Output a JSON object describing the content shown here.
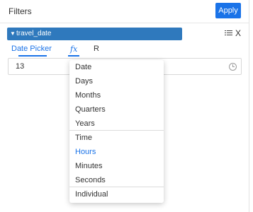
{
  "header": {
    "title": "Filters",
    "apply_label": "Apply"
  },
  "filter": {
    "name": "travel_date",
    "expand_icon": "caret-down-icon",
    "menu_icon": "list-icon",
    "close_label": "X",
    "tabs": [
      {
        "label": "Date Picker"
      },
      {
        "label": "fx"
      },
      {
        "label": "R"
      }
    ],
    "active_tab": "fx",
    "input": {
      "value": "13",
      "icon": "clock-icon"
    }
  },
  "dropdown": {
    "groups": [
      [
        "Date",
        "Days",
        "Months",
        "Quarters",
        "Years"
      ],
      [
        "Time",
        "Hours",
        "Minutes",
        "Seconds"
      ],
      [
        "Individual"
      ]
    ],
    "items": [
      "Date",
      "Days",
      "Months",
      "Quarters",
      "Years",
      "Time",
      "Hours",
      "Minutes",
      "Seconds",
      "Individual"
    ],
    "highlighted": "Hours",
    "highlight_color": "#1a73e8"
  },
  "colors": {
    "accent": "#1a73e8",
    "filter_header": "#2f79bd"
  }
}
